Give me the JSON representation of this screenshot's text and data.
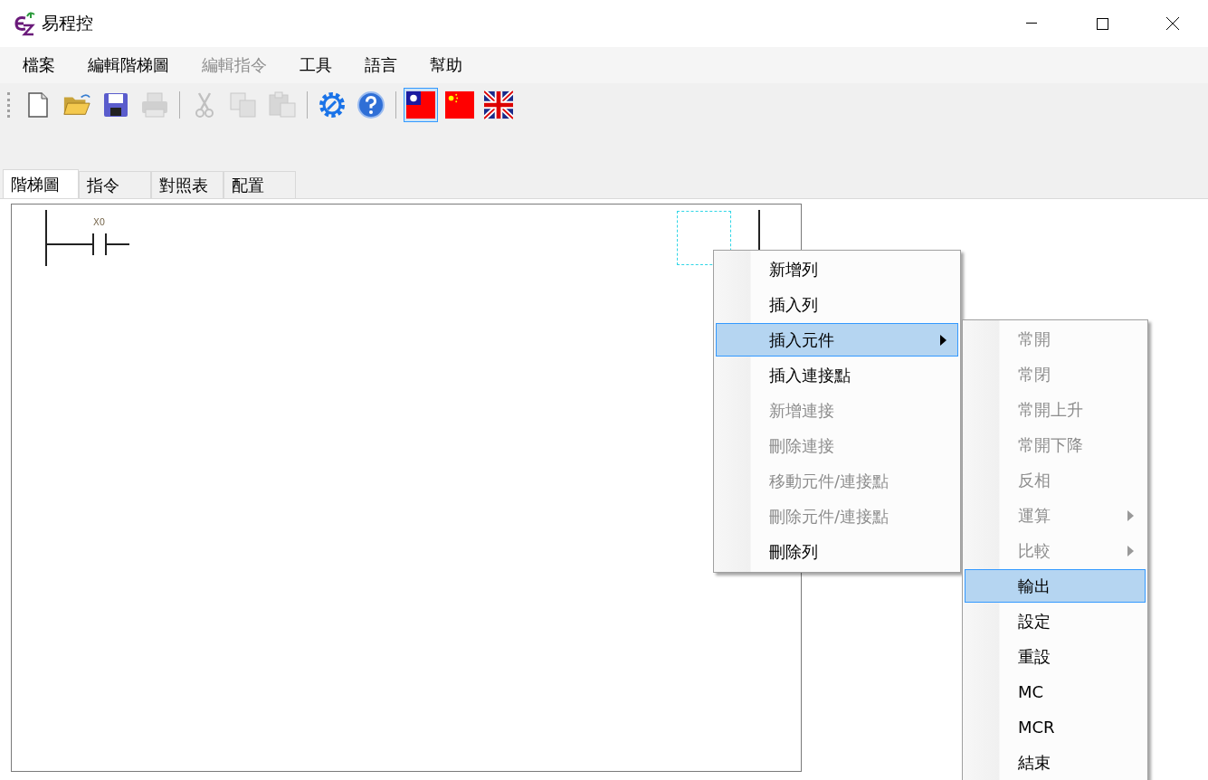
{
  "window": {
    "title": "易程控"
  },
  "menu_bar": [
    {
      "label": "檔案",
      "disabled": false
    },
    {
      "label": "編輯階梯圖",
      "disabled": false
    },
    {
      "label": "編輯指令",
      "disabled": true
    },
    {
      "label": "工具",
      "disabled": false
    },
    {
      "label": "語言",
      "disabled": false
    },
    {
      "label": "幫助",
      "disabled": false
    }
  ],
  "toolbar": [
    {
      "kind": "new",
      "disabled": false
    },
    {
      "kind": "open",
      "disabled": false
    },
    {
      "kind": "save",
      "disabled": false
    },
    {
      "kind": "print",
      "disabled": true
    },
    {
      "kind": "sep"
    },
    {
      "kind": "cut",
      "disabled": true
    },
    {
      "kind": "copy",
      "disabled": true
    },
    {
      "kind": "paste",
      "disabled": true
    },
    {
      "kind": "sep"
    },
    {
      "kind": "settings",
      "disabled": false
    },
    {
      "kind": "help",
      "disabled": false
    },
    {
      "kind": "sep"
    },
    {
      "kind": "flag_tw",
      "selected": true
    },
    {
      "kind": "flag_cn",
      "selected": false
    },
    {
      "kind": "flag_uk",
      "selected": false
    }
  ],
  "tabs": [
    {
      "label": "階梯圖",
      "selected": true
    },
    {
      "label": "指令",
      "selected": false
    },
    {
      "label": "對照表",
      "selected": false
    },
    {
      "label": "配置",
      "selected": false
    }
  ],
  "ladder": {
    "contact_label": "X0"
  },
  "context_menu": [
    {
      "label": "新增列",
      "disabled": false,
      "selected": false
    },
    {
      "label": "插入列",
      "disabled": false,
      "selected": false
    },
    {
      "label": "插入元件",
      "disabled": false,
      "selected": true,
      "submenu": true
    },
    {
      "label": "插入連接點",
      "disabled": false,
      "selected": false
    },
    {
      "label": "新增連接",
      "disabled": true,
      "selected": false
    },
    {
      "label": "刪除連接",
      "disabled": true,
      "selected": false
    },
    {
      "label": "移動元件/連接點",
      "disabled": true,
      "selected": false
    },
    {
      "label": "刪除元件/連接點",
      "disabled": true,
      "selected": false
    },
    {
      "label": "刪除列",
      "disabled": false,
      "selected": false
    }
  ],
  "submenu": [
    {
      "label": "常開",
      "disabled": true,
      "selected": false
    },
    {
      "label": "常閉",
      "disabled": true,
      "selected": false
    },
    {
      "label": "常開上升",
      "disabled": true,
      "selected": false
    },
    {
      "label": "常開下降",
      "disabled": true,
      "selected": false
    },
    {
      "label": "反相",
      "disabled": true,
      "selected": false
    },
    {
      "label": "運算",
      "disabled": true,
      "selected": false,
      "submenu": true
    },
    {
      "label": "比較",
      "disabled": true,
      "selected": false,
      "submenu": true
    },
    {
      "label": "輸出",
      "disabled": false,
      "selected": true
    },
    {
      "label": "設定",
      "disabled": false,
      "selected": false
    },
    {
      "label": "重設",
      "disabled": false,
      "selected": false
    },
    {
      "label": "MC",
      "disabled": false,
      "selected": false
    },
    {
      "label": "MCR",
      "disabled": false,
      "selected": false
    },
    {
      "label": "結束",
      "disabled": false,
      "selected": false
    }
  ]
}
